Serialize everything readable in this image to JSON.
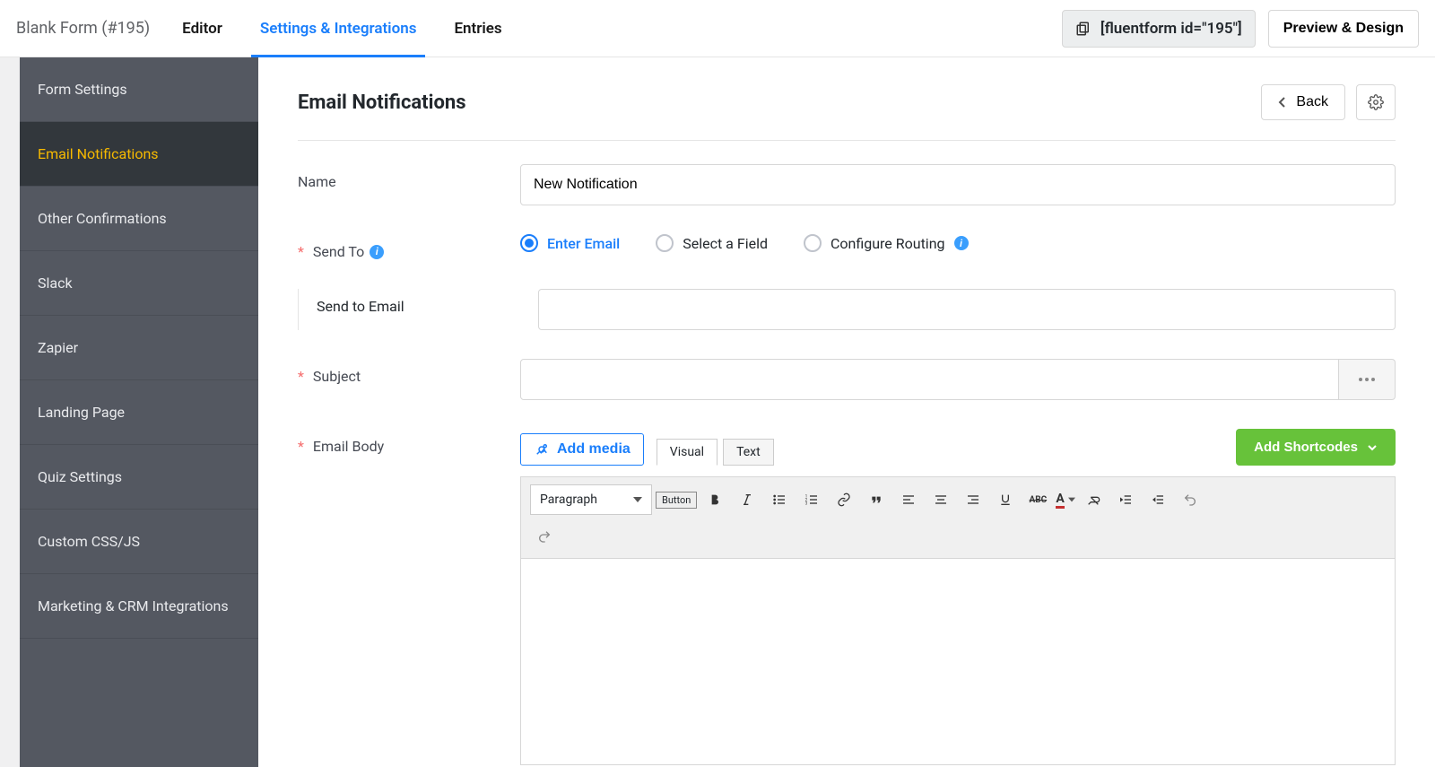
{
  "header": {
    "form_title": "Blank Form (#195)",
    "tabs": [
      "Editor",
      "Settings & Integrations",
      "Entries"
    ],
    "active_tab": 1,
    "shortcode": "[fluentform id=\"195\"]",
    "preview_btn": "Preview & Design"
  },
  "sidebar": {
    "items": [
      "Form Settings",
      "Email Notifications",
      "Other Confirmations",
      "Slack",
      "Zapier",
      "Landing Page",
      "Quiz Settings",
      "Custom CSS/JS",
      "Marketing & CRM Integrations"
    ],
    "active": 1
  },
  "page": {
    "title": "Email Notifications",
    "back_btn": "Back"
  },
  "form": {
    "name_label": "Name",
    "name_value": "New Notification",
    "send_to_label": "Send To",
    "send_to_options": [
      "Enter Email",
      "Select a Field",
      "Configure Routing"
    ],
    "send_to_selected": 0,
    "send_to_email_label": "Send to Email",
    "send_to_email_value": "",
    "subject_label": "Subject",
    "subject_value": "",
    "email_body_label": "Email Body"
  },
  "editor": {
    "add_media": "Add media",
    "tabs": [
      "Visual",
      "Text"
    ],
    "active_tab": 0,
    "add_shortcodes": "Add Shortcodes",
    "para_label": "Paragraph",
    "button_chip": "Button"
  }
}
